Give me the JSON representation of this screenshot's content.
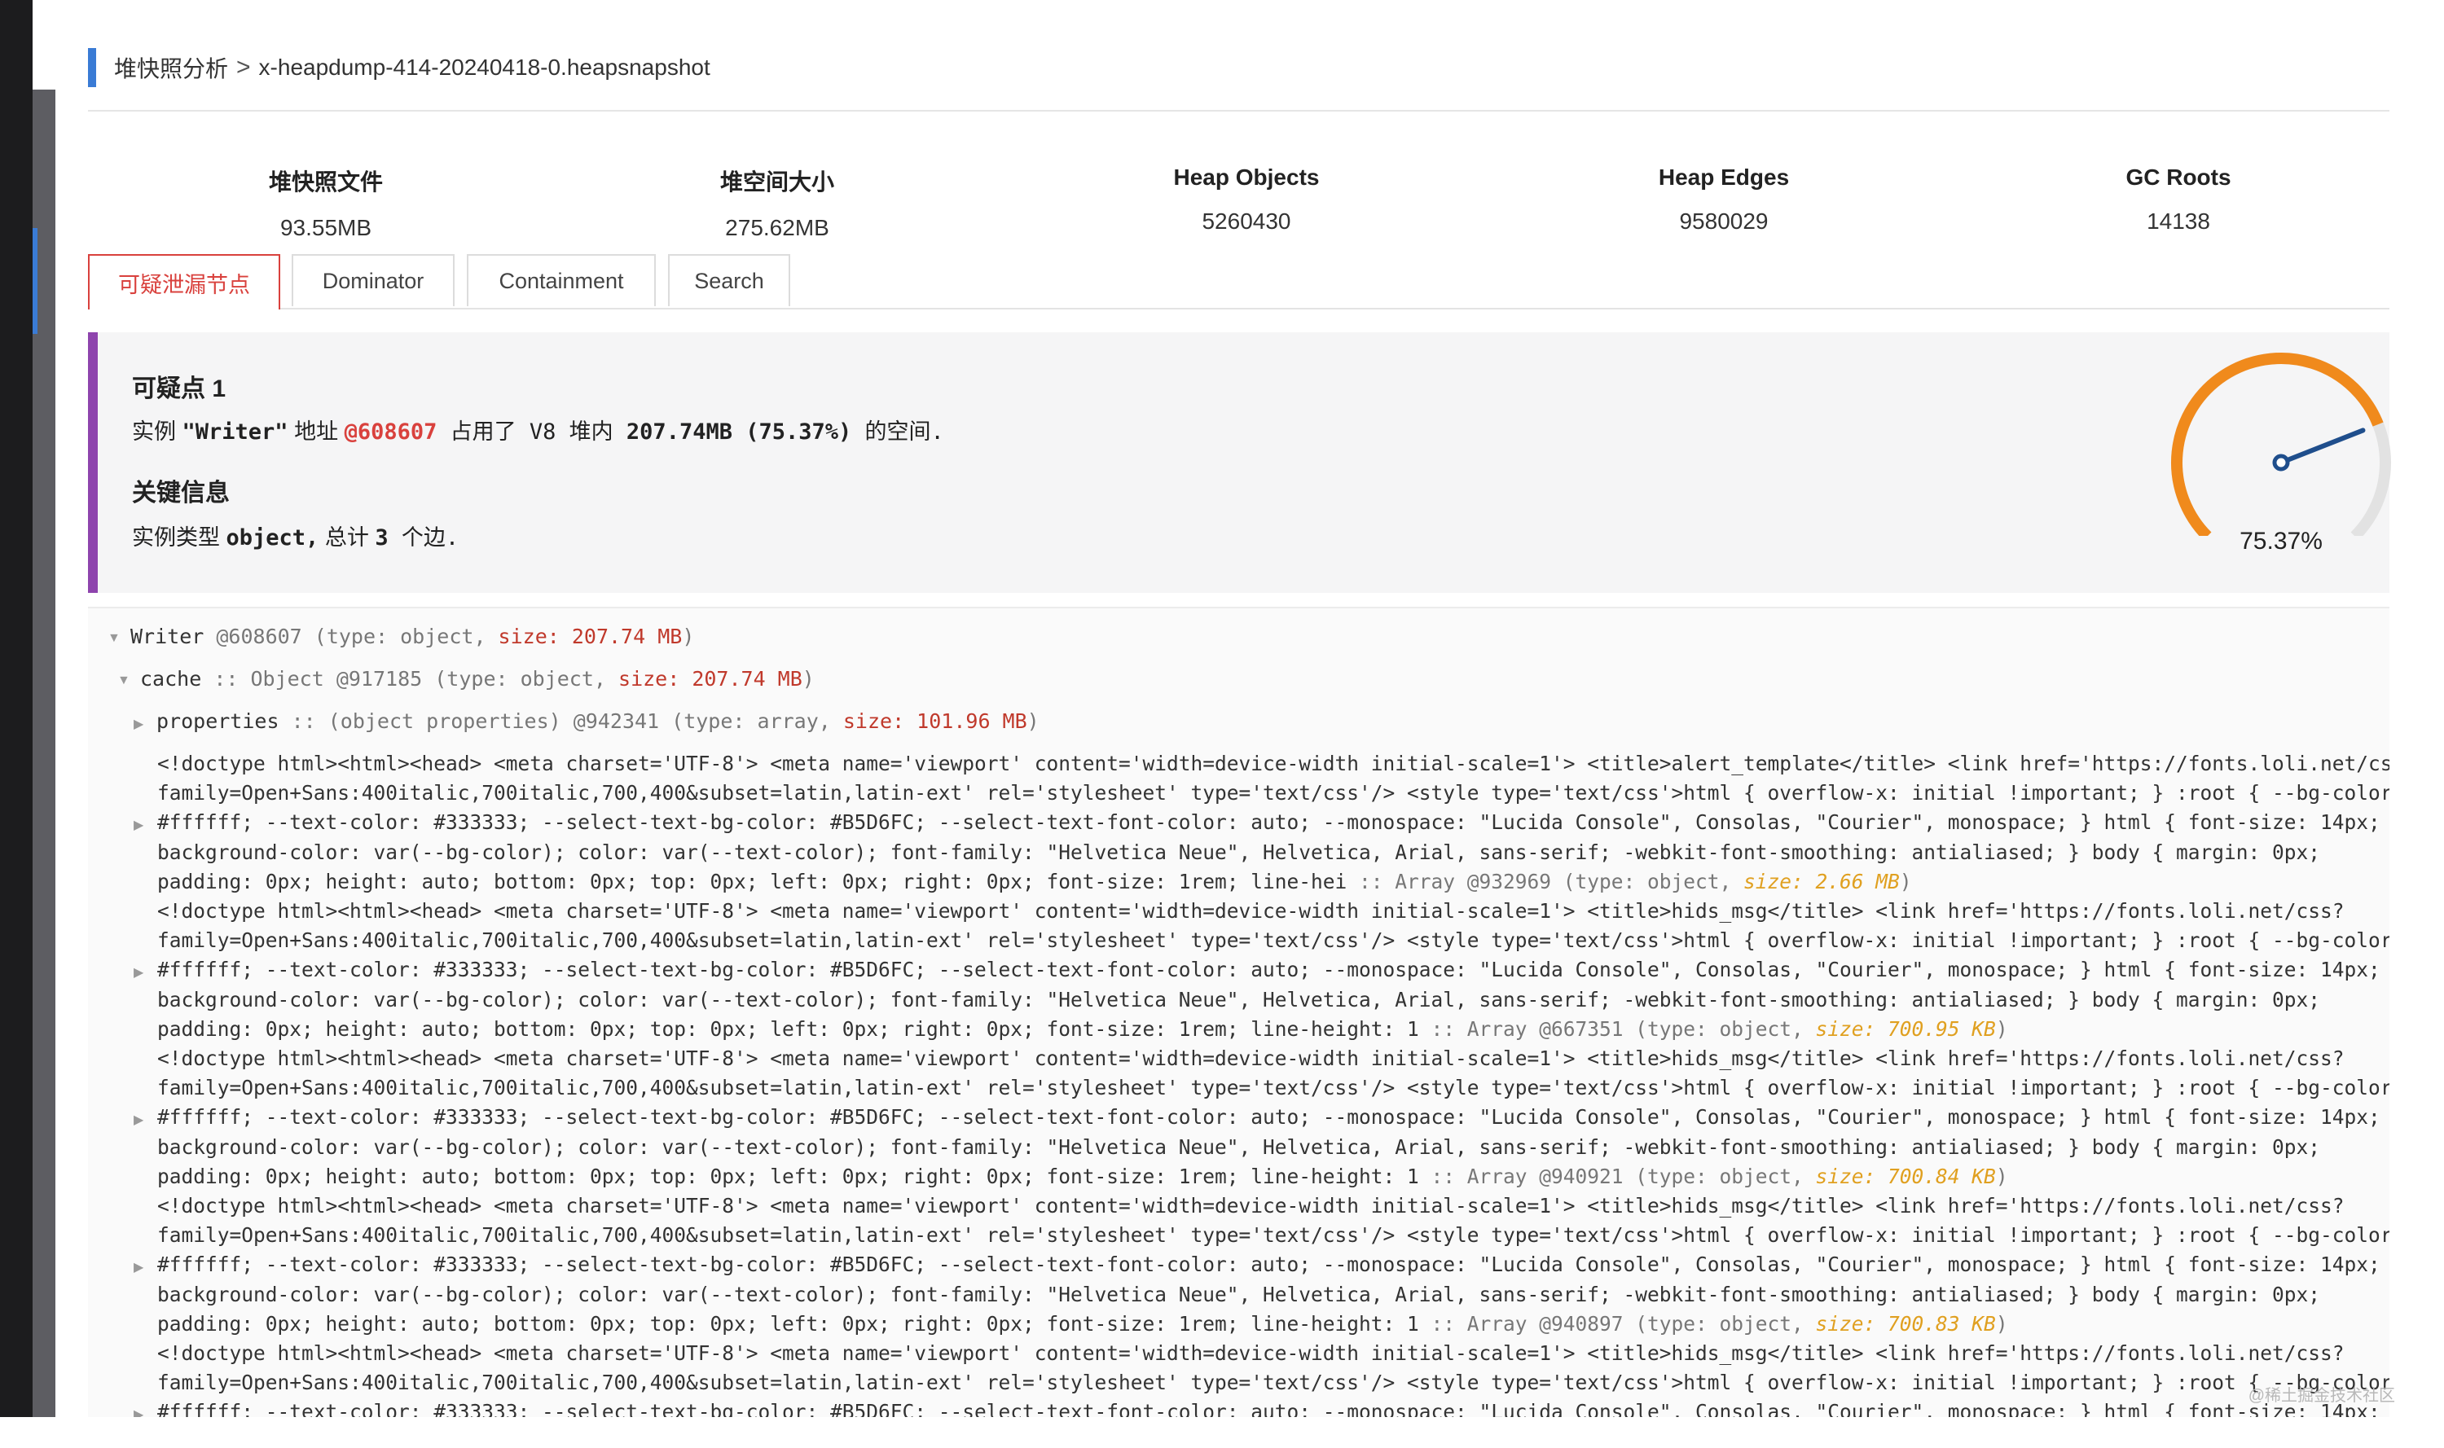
{
  "breadcrumb": {
    "root": "堆快照分析",
    "separator": ">",
    "file": "x-heapdump-414-20240418-0.heapsnapshot"
  },
  "stats": [
    {
      "label": "堆快照文件",
      "value": "93.55MB"
    },
    {
      "label": "堆空间大小",
      "value": "275.62MB"
    },
    {
      "label": "Heap Objects",
      "value": "5260430"
    },
    {
      "label": "Heap Edges",
      "value": "9580029"
    },
    {
      "label": "GC Roots",
      "value": "14138"
    }
  ],
  "tabs": [
    {
      "label": "可疑泄漏节点",
      "active": true
    },
    {
      "label": "Dominator",
      "active": false
    },
    {
      "label": "Containment",
      "active": false
    },
    {
      "label": "Search",
      "active": false
    }
  ],
  "suspect": {
    "title": "可疑点 1",
    "line1": {
      "pre": "实例 ",
      "name": "\"Writer\"",
      "mid1": " 地址 ",
      "address": "@608607",
      "mid2": " 占用了 V8 堆内 ",
      "amount": "207.74MB (75.37%)",
      "post": " 的空间."
    },
    "key_title": "关键信息",
    "line2": {
      "pre": "实例类型 ",
      "type": "object,",
      "mid": " 总计 ",
      "count": "3",
      "post": " 个边."
    },
    "gauge": {
      "percent": 75.37,
      "label": "75.37%",
      "color": "#f08a1c",
      "track_color": "#e2e2e2"
    }
  },
  "tree": {
    "root": {
      "name": "Writer",
      "meta": " @608607 (type: object, ",
      "size": "size: 207.74 MB",
      "close": ")"
    },
    "cache": {
      "name": "cache",
      "meta": " :: Object @917185 (type: object, ",
      "size": "size: 207.74 MB",
      "close": ")"
    },
    "properties": {
      "name": "properties",
      "meta": " :: (object properties) @942341 (type: array, ",
      "size": "size: 101.96 MB",
      "close": ")"
    },
    "entries": [
      {
        "lines": [
          "<!doctype html><html><head> <meta charset='UTF-8'> <meta name='viewport' content='width=device-width initial-scale=1'> <title>alert_template</title> <link href='https://fonts.loli.net/css?",
          "family=Open+Sans:400italic,700italic,700,400&subset=latin,latin-ext' rel='stylesheet' type='text/css'/> <style type='text/css'>html { overflow-x: initial !important; } :root { --bg-color:",
          "#ffffff; --text-color: #333333; --select-text-bg-color: #B5D6FC; --select-text-font-color: auto; --monospace: \"Lucida Console\", Consolas, \"Courier\", monospace; } html { font-size: 14px;",
          "background-color: var(--bg-color); color: var(--text-color); font-family: \"Helvetica Neue\", Helvetica, Arial, sans-serif; -webkit-font-smoothing: antialiased; } body { margin: 0px;"
        ],
        "last": "padding: 0px; height: auto; bottom: 0px; top: 0px; left: 0px; right: 0px; font-size: 1rem; line-hei",
        "meta": " :: Array @932969 (type: object, ",
        "size": "size: 2.66 MB",
        "close": ")"
      },
      {
        "lines": [
          "<!doctype html><html><head> <meta charset='UTF-8'> <meta name='viewport' content='width=device-width initial-scale=1'> <title>hids_msg</title> <link href='https://fonts.loli.net/css?",
          "family=Open+Sans:400italic,700italic,700,400&subset=latin,latin-ext' rel='stylesheet' type='text/css'/> <style type='text/css'>html { overflow-x: initial !important; } :root { --bg-color:",
          "#ffffff; --text-color: #333333; --select-text-bg-color: #B5D6FC; --select-text-font-color: auto; --monospace: \"Lucida Console\", Consolas, \"Courier\", monospace; } html { font-size: 14px;",
          "background-color: var(--bg-color); color: var(--text-color); font-family: \"Helvetica Neue\", Helvetica, Arial, sans-serif; -webkit-font-smoothing: antialiased; } body { margin: 0px;"
        ],
        "last": "padding: 0px; height: auto; bottom: 0px; top: 0px; left: 0px; right: 0px; font-size: 1rem; line-height: 1",
        "meta": " :: Array @667351 (type: object, ",
        "size": "size: 700.95 KB",
        "close": ")"
      },
      {
        "lines": [
          "<!doctype html><html><head> <meta charset='UTF-8'> <meta name='viewport' content='width=device-width initial-scale=1'> <title>hids_msg</title> <link href='https://fonts.loli.net/css?",
          "family=Open+Sans:400italic,700italic,700,400&subset=latin,latin-ext' rel='stylesheet' type='text/css'/> <style type='text/css'>html { overflow-x: initial !important; } :root { --bg-color:",
          "#ffffff; --text-color: #333333; --select-text-bg-color: #B5D6FC; --select-text-font-color: auto; --monospace: \"Lucida Console\", Consolas, \"Courier\", monospace; } html { font-size: 14px;",
          "background-color: var(--bg-color); color: var(--text-color); font-family: \"Helvetica Neue\", Helvetica, Arial, sans-serif; -webkit-font-smoothing: antialiased; } body { margin: 0px;"
        ],
        "last": "padding: 0px; height: auto; bottom: 0px; top: 0px; left: 0px; right: 0px; font-size: 1rem; line-height: 1",
        "meta": " :: Array @940921 (type: object, ",
        "size": "size: 700.84 KB",
        "close": ")"
      },
      {
        "lines": [
          "<!doctype html><html><head> <meta charset='UTF-8'> <meta name='viewport' content='width=device-width initial-scale=1'> <title>hids_msg</title> <link href='https://fonts.loli.net/css?",
          "family=Open+Sans:400italic,700italic,700,400&subset=latin,latin-ext' rel='stylesheet' type='text/css'/> <style type='text/css'>html { overflow-x: initial !important; } :root { --bg-color:",
          "#ffffff; --text-color: #333333; --select-text-bg-color: #B5D6FC; --select-text-font-color: auto; --monospace: \"Lucida Console\", Consolas, \"Courier\", monospace; } html { font-size: 14px;",
          "background-color: var(--bg-color); color: var(--text-color); font-family: \"Helvetica Neue\", Helvetica, Arial, sans-serif; -webkit-font-smoothing: antialiased; } body { margin: 0px;"
        ],
        "last": "padding: 0px; height: auto; bottom: 0px; top: 0px; left: 0px; right: 0px; font-size: 1rem; line-height: 1",
        "meta": " :: Array @940897 (type: object, ",
        "size": "size: 700.83 KB",
        "close": ")"
      },
      {
        "lines": [
          "<!doctype html><html><head> <meta charset='UTF-8'> <meta name='viewport' content='width=device-width initial-scale=1'> <title>hids_msg</title> <link href='https://fonts.loli.net/css?",
          "family=Open+Sans:400italic,700italic,700,400&subset=latin,latin-ext' rel='stylesheet' type='text/css'/> <style type='text/css'>html { overflow-x: initial !important; } :root { --bg-color:",
          "#ffffff; --text-color: #333333; --select-text-bg-color: #B5D6FC; --select-text-font-color: auto; --monospace: \"Lucida Console\", Consolas, \"Courier\", monospace; } html { font-size: 14px;"
        ],
        "last": "",
        "meta": "",
        "size": "",
        "close": ""
      }
    ]
  },
  "watermark": "@稀土掘金技术社区",
  "icons": {
    "tree_caret_open": "caret-down-icon",
    "tree_caret_closed": "caret-right-icon"
  }
}
